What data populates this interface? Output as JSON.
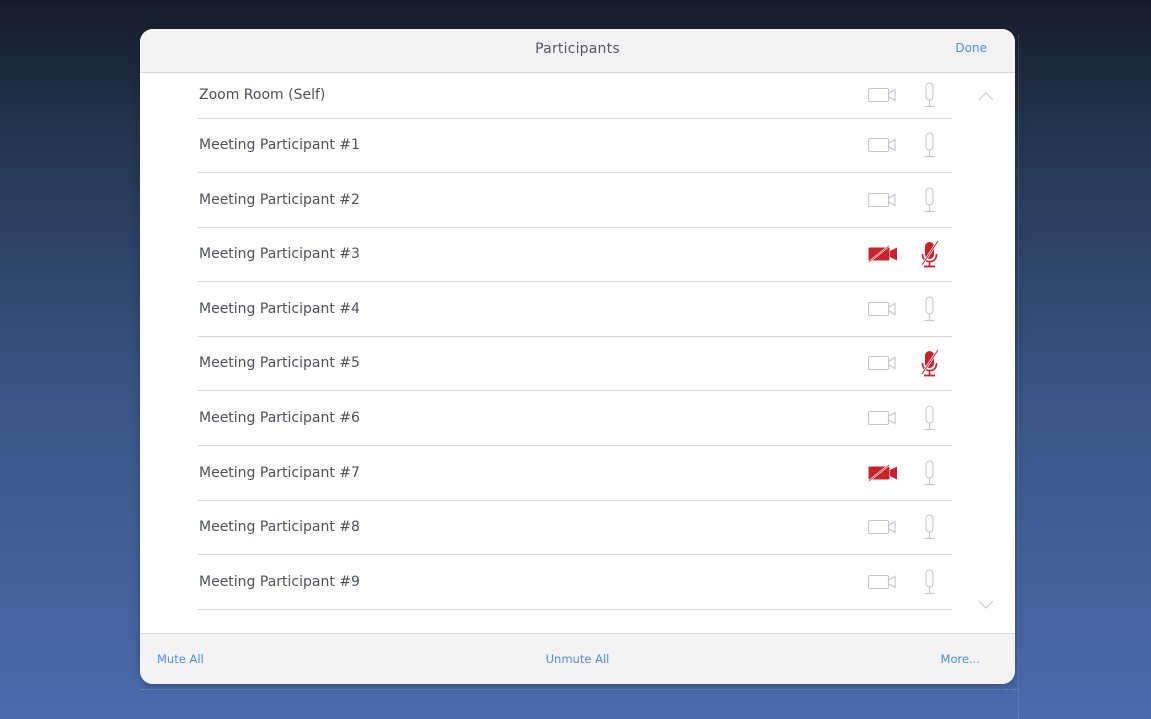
{
  "dialog": {
    "title": "Participants",
    "done_label": "Done"
  },
  "participants": [
    {
      "name": "Zoom Room (Self)",
      "video_off": false,
      "audio_muted": false
    },
    {
      "name": "Meeting Participant #1",
      "video_off": false,
      "audio_muted": false
    },
    {
      "name": "Meeting Participant #2",
      "video_off": false,
      "audio_muted": false
    },
    {
      "name": "Meeting Participant #3",
      "video_off": true,
      "audio_muted": true
    },
    {
      "name": "Meeting Participant #4",
      "video_off": false,
      "audio_muted": false
    },
    {
      "name": "Meeting Participant #5",
      "video_off": false,
      "audio_muted": true
    },
    {
      "name": "Meeting Participant #6",
      "video_off": false,
      "audio_muted": false
    },
    {
      "name": "Meeting Participant #7",
      "video_off": true,
      "audio_muted": false
    },
    {
      "name": "Meeting Participant #8",
      "video_off": false,
      "audio_muted": false
    },
    {
      "name": "Meeting Participant #9",
      "video_off": false,
      "audio_muted": false
    }
  ],
  "footer": {
    "mute_all_label": "Mute All",
    "unmute_all_label": "Unmute All",
    "more_label": "More..."
  },
  "icons": {
    "camera": "video-camera-icon",
    "camera_off": "video-camera-off-icon",
    "mic": "microphone-icon",
    "mic_muted": "microphone-muted-icon",
    "scroll_up": "chevron-up-icon",
    "scroll_down": "chevron-down-icon"
  },
  "colors": {
    "accent": "#4f8edb",
    "muted_red": "#c8232c",
    "icon_gray": "#c4c6cc"
  }
}
